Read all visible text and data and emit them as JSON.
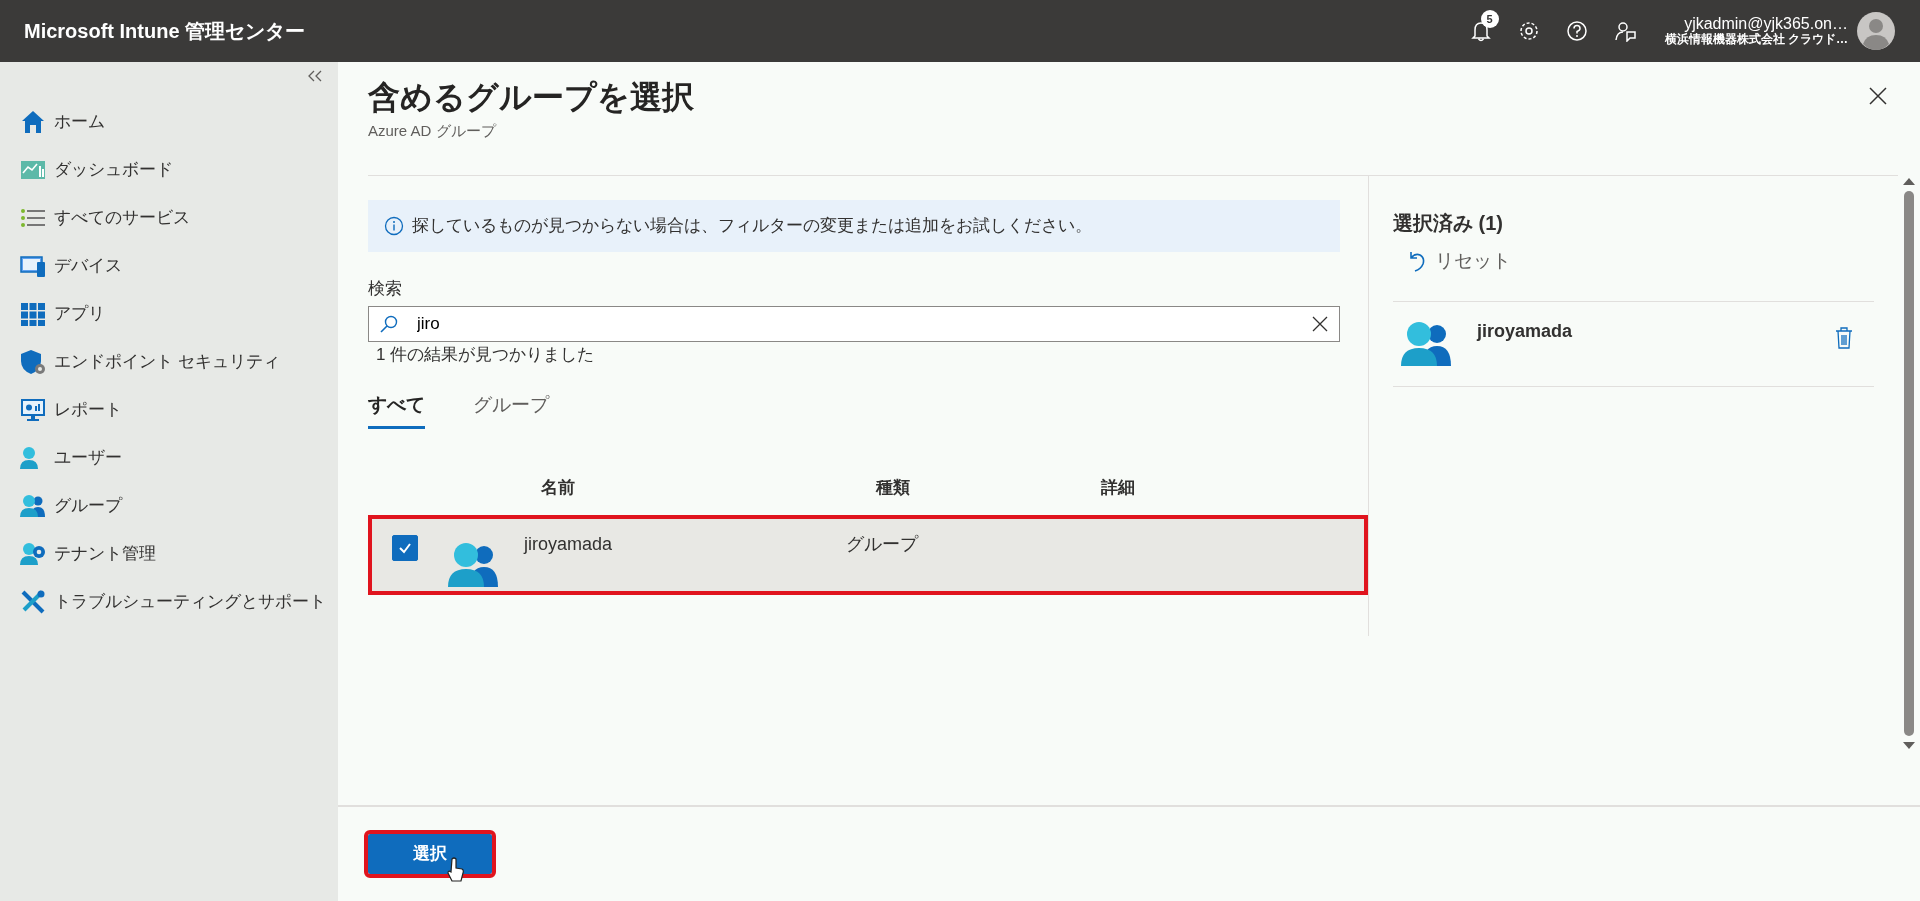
{
  "header": {
    "title": "Microsoft Intune 管理センター",
    "notification_count": "5",
    "account_email": "yjkadmin@yjk365.on…",
    "account_tenant": "横浜情報機器株式会社 クラウド…"
  },
  "sidebar": {
    "items": [
      {
        "label": "ホーム"
      },
      {
        "label": "ダッシュボード"
      },
      {
        "label": "すべてのサービス"
      },
      {
        "label": "デバイス"
      },
      {
        "label": "アプリ"
      },
      {
        "label": "エンドポイント セキュリティ"
      },
      {
        "label": "レポート"
      },
      {
        "label": "ユーザー"
      },
      {
        "label": "グループ"
      },
      {
        "label": "テナント管理"
      },
      {
        "label": "トラブルシューティングとサポート"
      }
    ]
  },
  "panel": {
    "title": "含めるグループを選択",
    "subtitle": "Azure AD グループ",
    "info": "探しているものが見つからない場合は、フィルターの変更または追加をお試しください。",
    "search": {
      "label": "検索",
      "value": "jiro"
    },
    "result_count": "1 件の結果が見つかりました",
    "tabs": [
      {
        "label": "すべて",
        "selected": true
      },
      {
        "label": "グループ",
        "selected": false
      }
    ],
    "table": {
      "columns": [
        "名前",
        "種類",
        "詳細"
      ],
      "rows": [
        {
          "name": "jiroyamada",
          "type": "グループ",
          "checked": true,
          "highlighted": true
        }
      ]
    }
  },
  "selected_panel": {
    "title": "選択済み (1)",
    "reset": "リセット",
    "items": [
      {
        "name": "jiroyamada"
      }
    ]
  },
  "footer": {
    "button": {
      "label": "選択",
      "highlighted": true
    }
  }
}
